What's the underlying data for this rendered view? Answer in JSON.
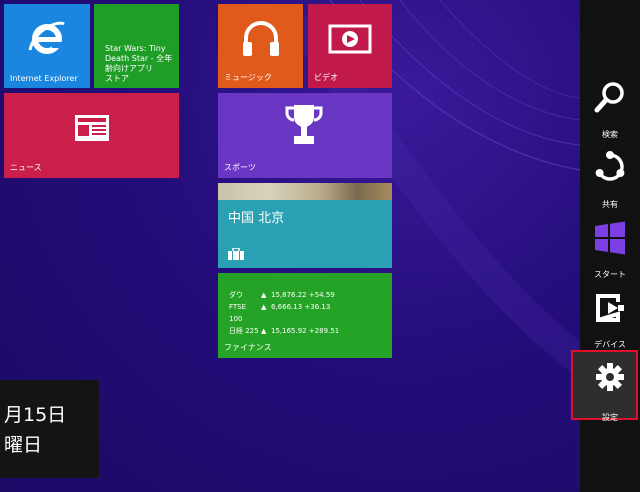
{
  "tiles": {
    "ie": {
      "label": "Internet Explorer",
      "color": "#1a86e0"
    },
    "starwars": {
      "text": "Star Wars: Tiny Death Star - 全年齢向けアプリストア",
      "line1": "Star Wars: Tiny",
      "line2": "Death Star - 全年",
      "line3": "齢向けアプリ",
      "line4": "ストア"
    },
    "news": {
      "label": "ニュース"
    },
    "music": {
      "label": "ミュージック"
    },
    "video": {
      "label": "ビデオ"
    },
    "sports": {
      "label": "スポーツ"
    },
    "weather": {
      "city": "中国 北京"
    },
    "finance": {
      "label": "ファイナンス",
      "rows": [
        {
          "name": "ダウ",
          "value": "15,876.22 +54.59"
        },
        {
          "name": "FTSE 100",
          "value": "6,666.13 +36.13"
        },
        {
          "name": "日経 225",
          "value": "15,165.92 +289.51"
        }
      ]
    }
  },
  "clock": {
    "date": "月15日",
    "weekday": "曜日"
  },
  "charms": {
    "search": {
      "label": "検索",
      "icon": "search-icon"
    },
    "share": {
      "label": "共有",
      "icon": "share-icon"
    },
    "start": {
      "label": "スタート",
      "icon": "windows-icon"
    },
    "devices": {
      "label": "デバイス",
      "icon": "devices-icon"
    },
    "settings": {
      "label": "設定",
      "icon": "gear-icon",
      "highlight_color": "#e0102a"
    }
  }
}
